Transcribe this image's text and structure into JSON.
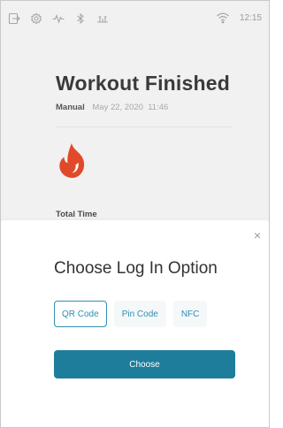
{
  "status_bar": {
    "icons": [
      "exit-icon",
      "settings-icon",
      "activity-icon",
      "bluetooth-icon",
      "usb-icon"
    ],
    "wifi_icon": "wifi-icon",
    "time": "12:15"
  },
  "workout": {
    "title": "Workout Finished",
    "mode": "Manual",
    "date": "May 22, 2020  11:46",
    "flame_icon": "flame-icon",
    "flame_color": "#e04a2a",
    "total_label": "Total Time"
  },
  "sheet": {
    "title": "Choose Log In Option",
    "options": [
      {
        "label": "QR Code",
        "selected": true
      },
      {
        "label": "Pin Code",
        "selected": false
      },
      {
        "label": "NFC",
        "selected": false
      }
    ],
    "choose_label": "Choose",
    "close_glyph": "×",
    "accent": "#1f7d9c"
  }
}
